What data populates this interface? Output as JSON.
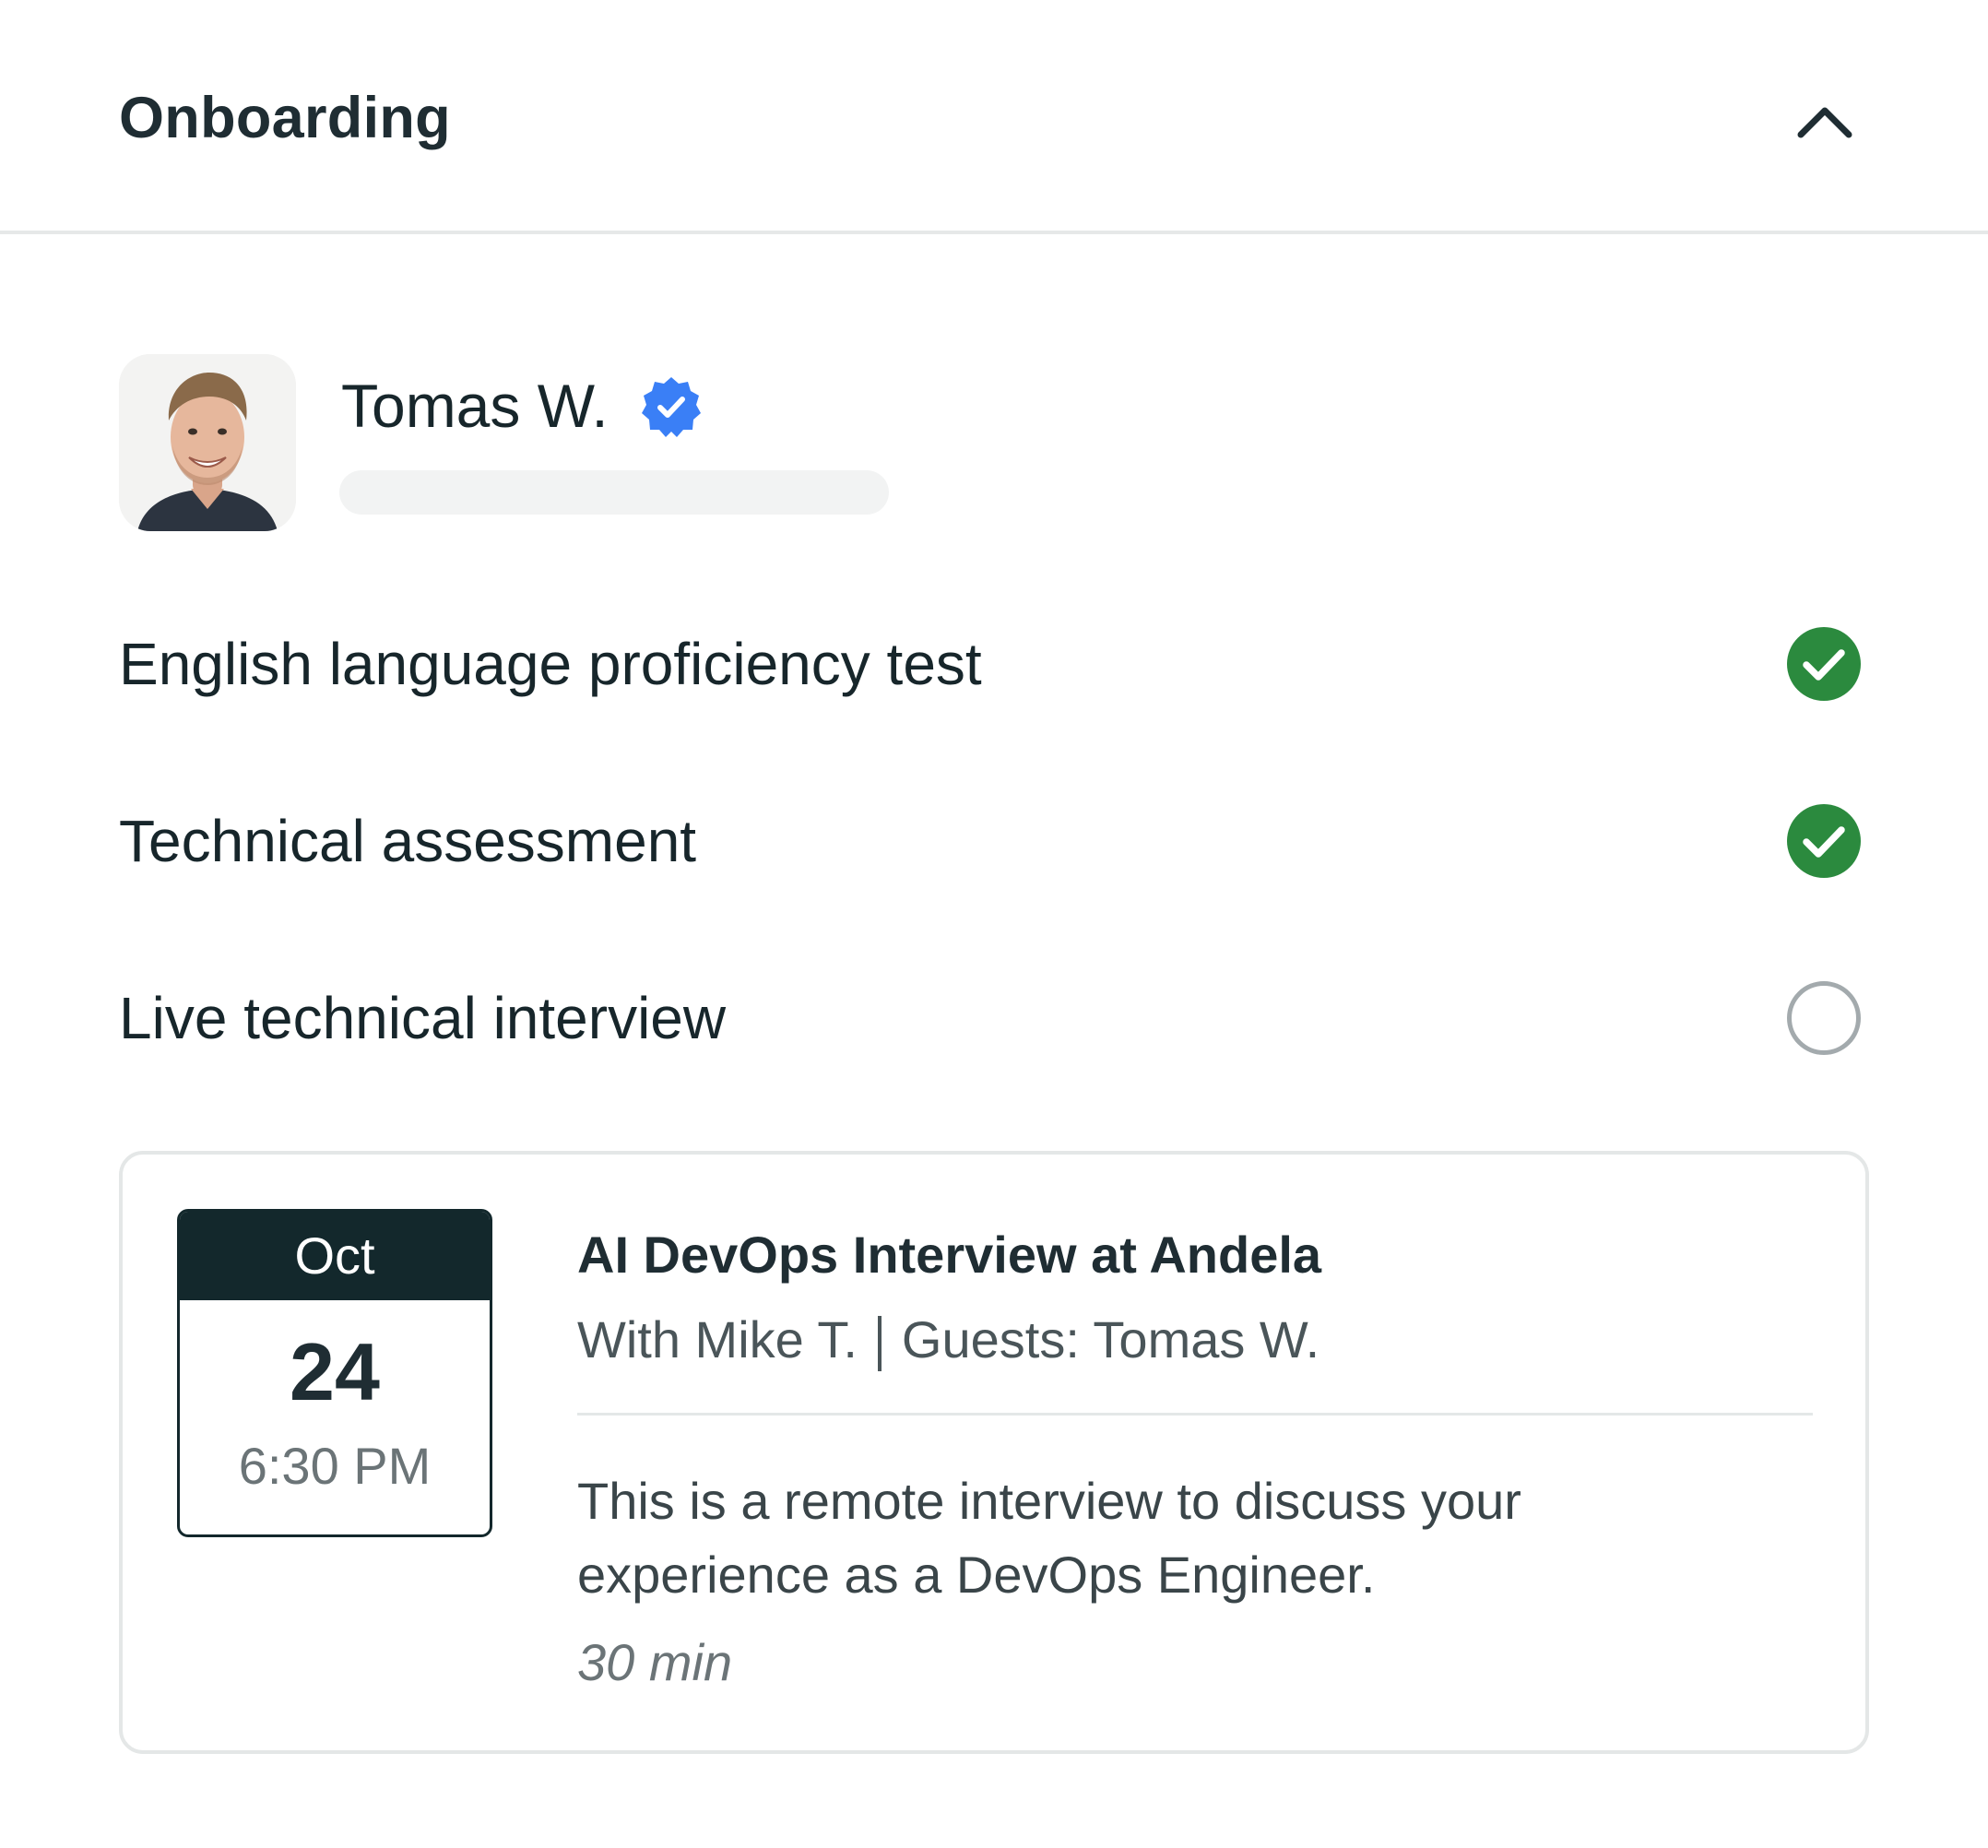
{
  "section": {
    "title": "Onboarding",
    "collapse_icon": "chevron-up-icon"
  },
  "profile": {
    "name": "Tomas W.",
    "verified_icon": "verified-badge-icon",
    "verified_color": "#3a7ff6"
  },
  "steps": [
    {
      "label": "English language proficiency test",
      "status": "complete"
    },
    {
      "label": "Technical assessment",
      "status": "complete"
    },
    {
      "label": "Live technical interview",
      "status": "pending"
    }
  ],
  "event": {
    "month": "Oct",
    "day": "24",
    "time": "6:30 PM",
    "title": "AI DevOps Interview at Andela",
    "host": "With Mike T.",
    "guests": "Guests: Tomas W.",
    "description": "This is a remote interview to discuss your experience as a DevOps Engineer.",
    "duration": "30 min"
  },
  "colors": {
    "complete": "#2b8a3e",
    "pending_ring": "#a3aaad",
    "calendar_header": "#13282c"
  }
}
